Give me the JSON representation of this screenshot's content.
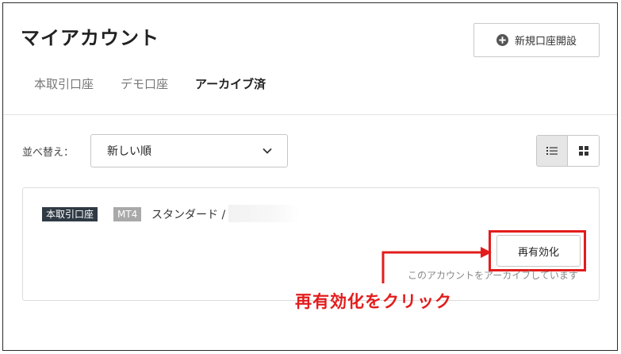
{
  "header": {
    "title": "マイアカウント",
    "new_account_label": "新規口座開設"
  },
  "tabs": [
    {
      "label": "本取引口座",
      "active": false
    },
    {
      "label": "デモ口座",
      "active": false
    },
    {
      "label": "アーカイブ済",
      "active": true
    }
  ],
  "sort": {
    "label": "並べ替え：",
    "selected": "新しい順"
  },
  "view_toggle": {
    "active": "list"
  },
  "account": {
    "badge_type": "本取引口座",
    "badge_platform": "MT4",
    "account_type": "スタンダード /",
    "reactivate_label": "再有効化",
    "archived_note": "このアカウントをアーカイブしています"
  },
  "annotation": {
    "text": "再有効化をクリック",
    "color": "#e31c1c"
  },
  "colors": {
    "badge_dark": "#2f3a45",
    "badge_gray": "#a9a9a9",
    "annotation_red": "#e31c1c"
  }
}
